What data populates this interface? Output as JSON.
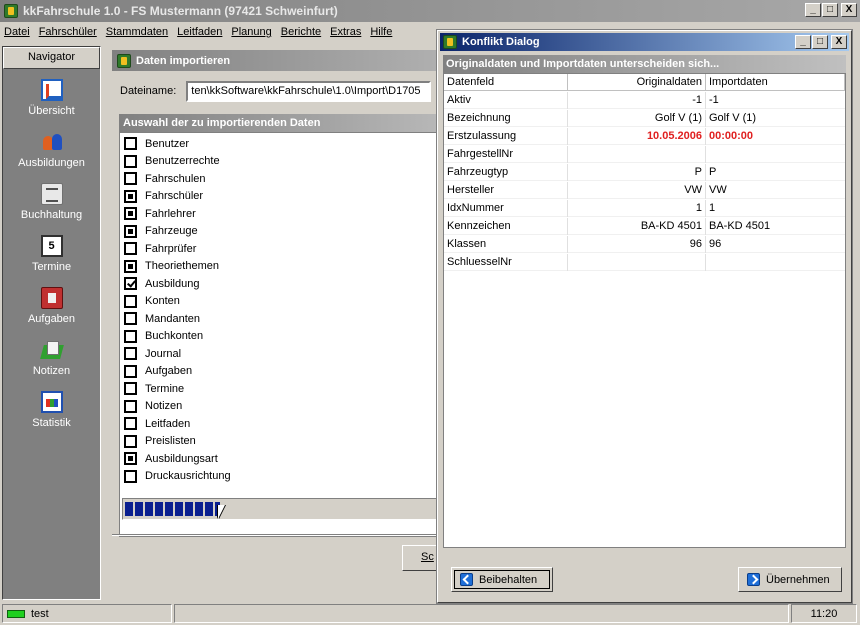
{
  "app": {
    "title": "kkFahrschule 1.0  -  FS Mustermann (97421 Schweinfurt)",
    "window_buttons": [
      "_",
      "□",
      "X"
    ]
  },
  "menu": [
    "Datei",
    "Fahrschüler",
    "Stammdaten",
    "Leitfaden",
    "Planung",
    "Berichte",
    "Extras",
    "Hilfe"
  ],
  "navigator": {
    "header": "Navigator",
    "items": [
      {
        "label": "Übersicht",
        "icon": "overview-icon"
      },
      {
        "label": "Ausbildungen",
        "icon": "people-icon"
      },
      {
        "label": "Buchhaltung",
        "icon": "cash-register-icon"
      },
      {
        "label": "Termine",
        "icon": "calendar-icon",
        "icon_text": "5"
      },
      {
        "label": "Aufgaben",
        "icon": "task-icon"
      },
      {
        "label": "Notizen",
        "icon": "notes-icon"
      },
      {
        "label": "Statistik",
        "icon": "statistics-icon"
      }
    ]
  },
  "import_window": {
    "title": "Daten importieren",
    "file_label": "Dateiname:",
    "file_value": "ten\\kkSoftware\\kkFahrschule\\1.0\\Import\\D1705",
    "section_title": "Auswahl der zu importierenden Daten",
    "items": [
      {
        "label": "Benutzer",
        "state": "empty"
      },
      {
        "label": "Benutzerrechte",
        "state": "empty"
      },
      {
        "label": "Fahrschulen",
        "state": "empty"
      },
      {
        "label": "Fahrschüler",
        "state": "filled"
      },
      {
        "label": "Fahrlehrer",
        "state": "filled"
      },
      {
        "label": "Fahrzeuge",
        "state": "filled"
      },
      {
        "label": "Fahrprüfer",
        "state": "empty"
      },
      {
        "label": "Theoriethemen",
        "state": "filled"
      },
      {
        "label": "Ausbildung",
        "state": "checked"
      },
      {
        "label": "Konten",
        "state": "empty"
      },
      {
        "label": "Mandanten",
        "state": "empty"
      },
      {
        "label": "Buchkonten",
        "state": "empty"
      },
      {
        "label": "Journal",
        "state": "empty"
      },
      {
        "label": "Aufgaben",
        "state": "empty"
      },
      {
        "label": "Termine",
        "state": "empty"
      },
      {
        "label": "Notizen",
        "state": "empty"
      },
      {
        "label": "Leitfaden",
        "state": "empty"
      },
      {
        "label": "Preislisten",
        "state": "empty"
      },
      {
        "label": "Ausbildungsart",
        "state": "filled"
      },
      {
        "label": "Druckausrichtung",
        "state": "empty"
      }
    ],
    "progress_fraction": 0.3,
    "partial_button_label": "Sc"
  },
  "dialog": {
    "title": "Konflikt Dialog",
    "subtitle": "Originaldaten und Importdaten unterscheiden sich...",
    "columns": [
      "Datenfeld",
      "Originaldaten",
      "Importdaten"
    ],
    "rows": [
      {
        "field": "Aktiv",
        "orig": "-1",
        "imp": "-1",
        "conflict": false
      },
      {
        "field": "Bezeichnung",
        "orig": "Golf V (1)",
        "imp": "Golf V (1)",
        "conflict": false
      },
      {
        "field": "Erstzulassung",
        "orig": "10.05.2006",
        "imp": "00:00:00",
        "conflict": true
      },
      {
        "field": "FahrgestellNr",
        "orig": "",
        "imp": "",
        "conflict": false
      },
      {
        "field": "Fahrzeugtyp",
        "orig": "P",
        "imp": "P",
        "conflict": false
      },
      {
        "field": "Hersteller",
        "orig": "VW",
        "imp": "VW",
        "conflict": false
      },
      {
        "field": "IdxNummer",
        "orig": "1",
        "imp": "1",
        "conflict": false
      },
      {
        "field": "Kennzeichen",
        "orig": "BA-KD 4501",
        "imp": "BA-KD 4501",
        "conflict": false
      },
      {
        "field": "Klassen",
        "orig": "96",
        "imp": "96",
        "conflict": false
      },
      {
        "field": "SchluesselNr",
        "orig": "",
        "imp": "",
        "conflict": false
      }
    ],
    "keep_button": "Beibehalten",
    "apply_button": "Übernehmen",
    "conflict_color": "#e02020"
  },
  "status": {
    "user": "test",
    "time": "11:20"
  }
}
